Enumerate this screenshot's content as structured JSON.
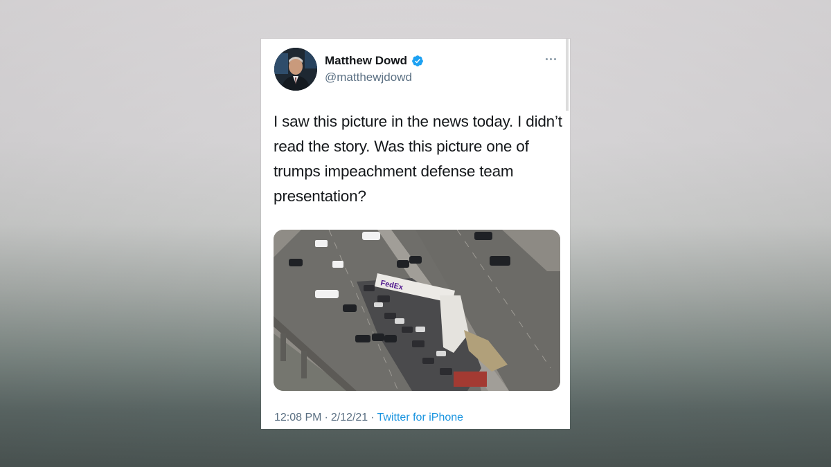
{
  "tweet": {
    "author": {
      "display_name": "Matthew Dowd",
      "handle": "@matthewjdowd",
      "verified": true,
      "avatar_icon": "person-avatar"
    },
    "more_icon": "ellipsis-icon",
    "text": "I saw this picture in the news today. I didn’t read the story. Was this picture one of trumps impeachment defense team presentation?",
    "media": {
      "truck_logo_text": "FedEx"
    },
    "meta": {
      "time": "12:08 PM",
      "separator": "·",
      "date": "2/12/21",
      "source": "Twitter for iPhone"
    }
  },
  "colors": {
    "verified_blue": "#1da1f2",
    "link_blue": "#1b95e0",
    "muted_gray": "#5b7083"
  }
}
